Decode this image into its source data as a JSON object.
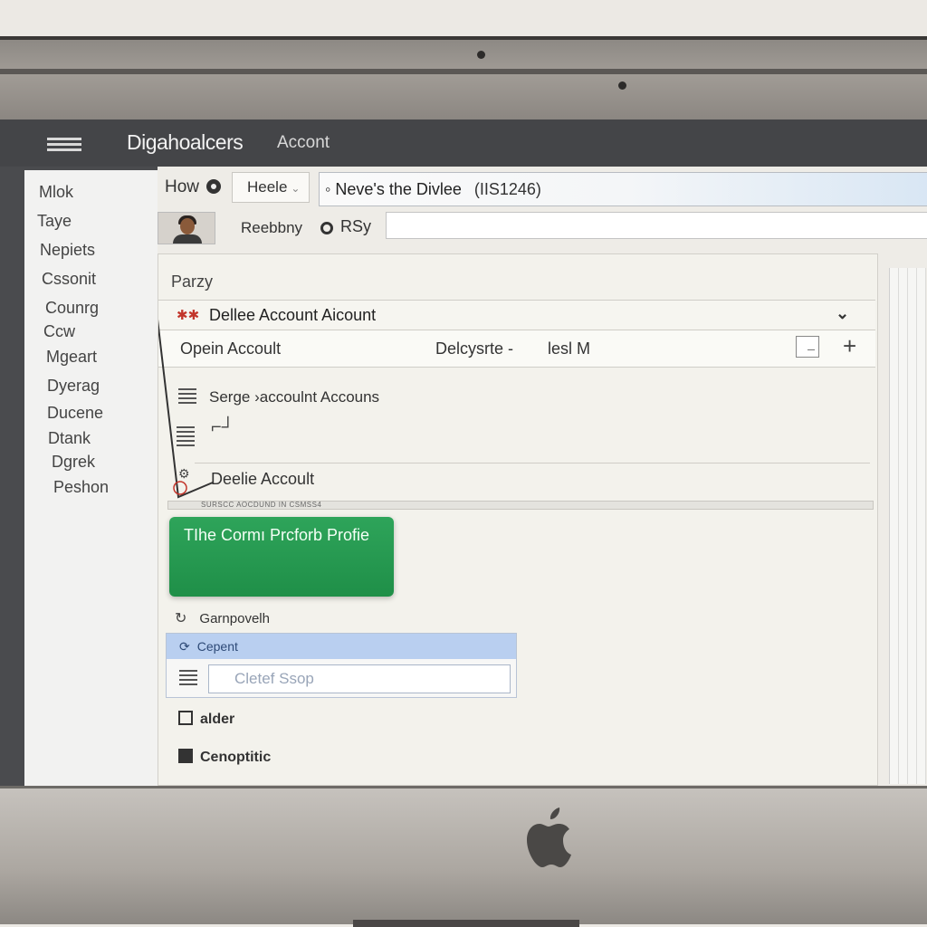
{
  "window": {
    "app_title": "Digahoalcers",
    "app_subtitle": "Accont"
  },
  "sidebar": {
    "items": [
      {
        "label": "Mlok"
      },
      {
        "label": "Taye"
      },
      {
        "label": "Nepiets"
      },
      {
        "label": "Cssonit"
      },
      {
        "label": "Counrg"
      },
      {
        "label": "Ccw"
      },
      {
        "label": "Mgeart"
      },
      {
        "label": "Dyerag"
      },
      {
        "label": "Ducene"
      },
      {
        "label": "Dtank"
      },
      {
        "label": "Dgrek"
      },
      {
        "label": "Peshon"
      }
    ]
  },
  "toolbar": {
    "how_label": "How",
    "here_tab_label": "Heele",
    "address_text": "Neve's the Divlee",
    "address_code": "(IIS1246)"
  },
  "user_row": {
    "username": "Reebbny",
    "rsy_label": "RSy",
    "input_value": ""
  },
  "card": {
    "title": "Parzy",
    "account_row_label": "Dellee Account Aicount",
    "open_row": {
      "col1": "Opein Accoult",
      "col2": "Delcysrte -",
      "col3": "lesl M"
    },
    "merge_label": "Serge ›accoulnt Accouns",
    "delete_label": "Deelie Accoult",
    "divider_text": "SURSCC AOCDUND IN CSMSS4",
    "green_button_label": "TIhe  Cormı Prcforb Profie",
    "comp_label": "Garnpovelh",
    "dropdown_header": "Cepent",
    "dropdown_field_value": "Cletef Ssop",
    "folder_label": "alder",
    "comp2_label": "Cenoptitic"
  },
  "colors": {
    "menubar": "#444548",
    "green_button": "#1f8f48",
    "dropdown_header": "#b9cff0",
    "account_icon": "#c2352b"
  }
}
